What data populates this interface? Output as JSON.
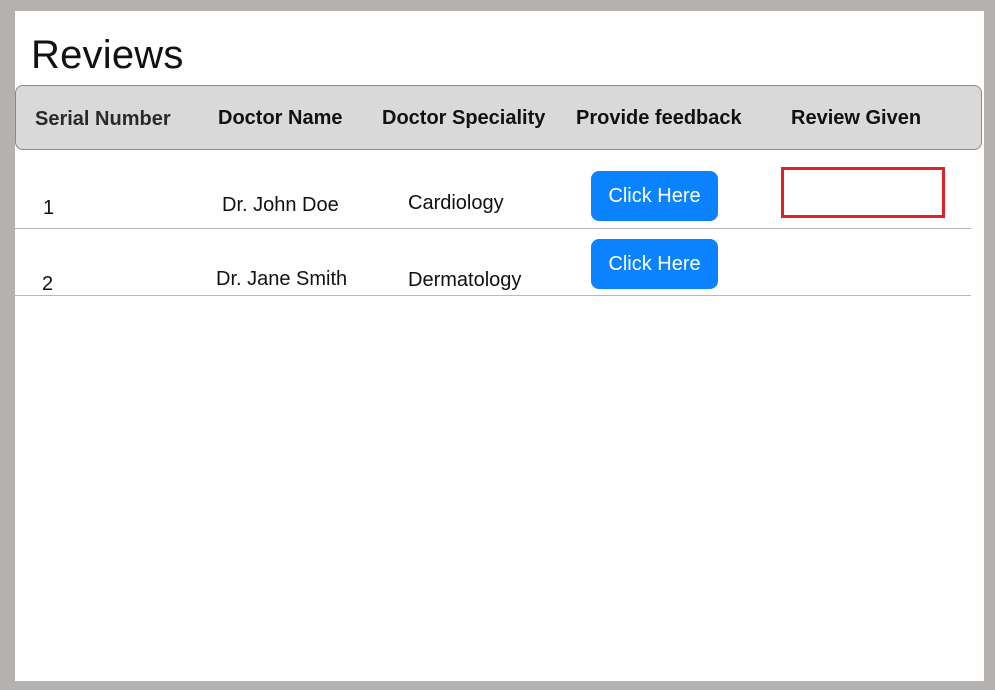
{
  "page": {
    "title": "Reviews"
  },
  "table": {
    "headers": {
      "serial": "Serial Number",
      "doctor_name": "Doctor Name",
      "speciality": "Doctor Speciality",
      "feedback": "Provide feedback",
      "review": "Review Given"
    },
    "rows": [
      {
        "serial": "1",
        "doctor_name": "Dr. John Doe",
        "speciality": "Cardiology",
        "feedback_button": "Click Here",
        "review_given": ""
      },
      {
        "serial": "2",
        "doctor_name": "Dr. Jane Smith",
        "speciality": "Dermatology",
        "feedback_button": "Click Here",
        "review_given": ""
      }
    ]
  },
  "colors": {
    "background": "#b5b1af",
    "header_bg": "#d9d9d9",
    "button": "#0b82ff",
    "highlight_border": "#e0212b"
  }
}
